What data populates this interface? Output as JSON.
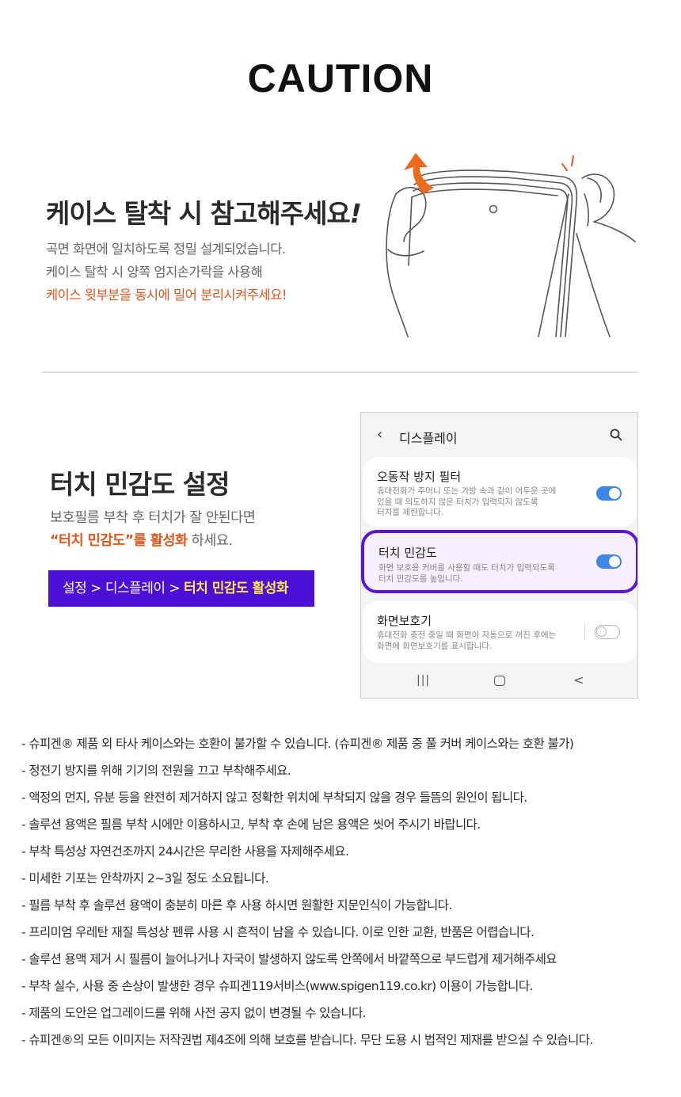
{
  "title": "CAUTION",
  "removal": {
    "heading": "케이스 탈착 시 참고해주세요",
    "heading_mark": "!",
    "line1": "곡면 화면에 일치하도록 정밀 설계되었습니다.",
    "line2": "케이스 탈착 시 양쪽 엄지손가락을 사용해",
    "line3": "케이스 윗부분을 동시에 밀어 분리시켜주세요!"
  },
  "touch": {
    "heading": "터치 민감도 설정",
    "line1": "보호필름 부착 후 터치가 잘 안된다면",
    "line2_highlight": "“터치 민감도”를 활성화",
    "line2_rest": " 하세요.",
    "path_prefix": "설정 > 디스플레이 > ",
    "path_highlight": "터치 민감도 활성화"
  },
  "phone": {
    "back_glyph": "‹",
    "screen_title": "디스플레이",
    "items": [
      {
        "title": "오동작 방지 필터",
        "desc1": "휴대전화가 주머니 또는 가방 속과 같이 어두운 곳에",
        "desc2": "있을 때 의도하지 않은 터치가 입력되지 않도록",
        "desc3": "터치를 제한합니다.",
        "toggle": "on"
      },
      {
        "title": "터치 민감도",
        "desc1": "화면 보호용 커버를 사용할 때도 터치가 입력되도록",
        "desc2": "터치 민감도를 높입니다.",
        "toggle": "on"
      },
      {
        "title": "화면보호기",
        "desc1": "휴대전화 충전 중일 때 화면이 자동으로 꺼진 후에는",
        "desc2": "화면에 화면보호기를 표시합니다.",
        "toggle": "off"
      }
    ],
    "nav": {
      "recent_glyph": "|||",
      "back_glyph": "<"
    }
  },
  "notes": [
    "- 슈피겐® 제품 외 타사 케이스와는 호환이 불가할 수 있습니다. (슈피겐® 제품 중 풀 커버 케이스와는 호환 불가)",
    "- 정전기 방지를 위해 기기의 전원을 끄고 부착해주세요.",
    "- 액정의 먼지, 유분 등을 완전히 제거하지 않고 정확한 위치에 부착되지 않을 경우 들뜸의 원인이 됩니다.",
    "- 솔루션 용액은 필름 부착 시에만 이용하시고, 부착 후 손에 남은 용액은 씻어 주시기 바랍니다.",
    "- 부착 특성상 자연건조까지 24시간은 무리한 사용을 자제해주세요.",
    "- 미세한 기포는 안착까지 2~3일 정도 소요됩니다.",
    "- 필름 부착 후 솔루션 용액이 충분히 마른 후 사용 하시면 원활한 지문인식이 가능합니다.",
    "- 프리미엄 우레탄 재질 특성상 펜류 사용 시 흔적이 남을 수 있습니다. 이로 인한 교환, 반품은 어렵습니다.",
    "- 솔루션 용액 제거 시 필름이 늘어나거나 자국이 발생하지 않도록 안쪽에서 바깥쪽으로 부드럽게 제거해주세요",
    "- 부착 실수, 사용 중 손상이 발생한 경우 슈피겐119서비스(www.spigen119.co.kr) 이용이 가능합니다.",
    "- 제품의 도안은 업그레이드를 위해 사전 공지 없이 변경될 수 있습니다.",
    "- 슈피겐®의 모든 이미지는 저작권법 제4조에 의해 보호를 받습니다. 무단 도용 시 법적인 제재를 받으실 수 있습니다."
  ],
  "colors": {
    "highlight_orange": "#e0561b",
    "path_box_bg": "#4b0fd6",
    "path_highlight": "#ffe94a",
    "toggle_on": "#3e86e8",
    "selection_outline": "#5a16d8"
  },
  "icons": [
    "search-icon",
    "back-arrow-icon",
    "home-icon",
    "recent-apps-icon",
    "nav-back-icon",
    "hands-removing-case-illustration",
    "lift-arrow-icon"
  ]
}
